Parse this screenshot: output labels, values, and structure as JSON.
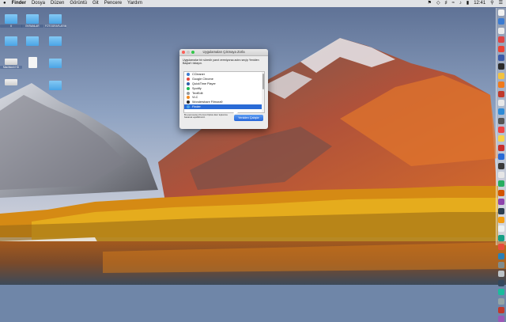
{
  "menubar": {
    "apple": "",
    "app": "Finder",
    "items": [
      "Dosya",
      "Düzen",
      "Görüntü",
      "Git",
      "Pencere",
      "Yardım"
    ],
    "clock": "12:41"
  },
  "desktop": {
    "icons": [
      {
        "name": "desktop-folder-1",
        "type": "folder",
        "label": "II"
      },
      {
        "name": "desktop-folder-2",
        "type": "folder",
        "label": "EKRANLAR"
      },
      {
        "name": "desktop-folder-3",
        "type": "folder",
        "label": "FOTOGRAFLARIM"
      },
      {
        "name": "desktop-folder-4",
        "type": "folder",
        "label": ""
      },
      {
        "name": "desktop-folder-5",
        "type": "folder",
        "label": ""
      },
      {
        "name": "desktop-folder-6",
        "type": "folder",
        "label": ""
      },
      {
        "name": "desktop-drive-1",
        "type": "drive",
        "label": "Macintosh HD"
      },
      {
        "name": "desktop-doc-1",
        "type": "doc",
        "label": ""
      },
      {
        "name": "desktop-folder-7",
        "type": "folder",
        "label": ""
      },
      {
        "name": "desktop-drive-2",
        "type": "drive",
        "label": ""
      },
      {
        "name": "desktop-folder-8",
        "type": "folder",
        "label": ""
      }
    ]
  },
  "dialog": {
    "title": "Uygulamaları Çıkmaya Zorla",
    "description": "Uygulamalar bir süredir yanıt vermiyorsa adını seçip Yeniden Başlat'ı tıklayın.",
    "apps": [
      {
        "label": "CCleaner",
        "color": "#3b7bd1",
        "selected": false
      },
      {
        "label": "Google Chrome",
        "color": "#e2483d",
        "selected": false
      },
      {
        "label": "QuickTime Player",
        "color": "#2f5fa8",
        "selected": false
      },
      {
        "label": "Spotify",
        "color": "#1db954",
        "selected": false
      },
      {
        "label": "TextEdit",
        "color": "#9a9a9a",
        "selected": false
      },
      {
        "label": "VLC",
        "color": "#f28a1b",
        "selected": false
      },
      {
        "label": "Wondershare Filmora9",
        "color": "#2a2a2a",
        "selected": false
      },
      {
        "label": "Finder",
        "color": "#4aa4e6",
        "selected": true
      }
    ],
    "hint": "Bu penceareyi Komut-Option-Esc tuşlarına basarak açabilirsiniz.",
    "button_label": "Yeniden Çalıştır"
  },
  "dock": {
    "colors": [
      "#f0f0f0",
      "#3b7bd1",
      "#e9e9e9",
      "#d44",
      "#ea4335",
      "#3c5ba8",
      "#2b2b2b",
      "#f3c240",
      "#f17b1d",
      "#c0392b",
      "#e8e8e8",
      "#2e8bd6",
      "#555",
      "#e44",
      "#f6d34a",
      "#c9302c",
      "#2a6bd6",
      "#3a3a3a",
      "#e6e6e6",
      "#27ae60",
      "#d35400",
      "#8e44ad",
      "#2c3e50",
      "#f39c12",
      "#ecf0f1",
      "#16a085",
      "#e74c3c",
      "#2980b9",
      "#7f8c8d",
      "#bdc3c7",
      "#34495e",
      "#1abc9c",
      "#95a5a6",
      "#c0392b",
      "#9b59b6"
    ]
  }
}
